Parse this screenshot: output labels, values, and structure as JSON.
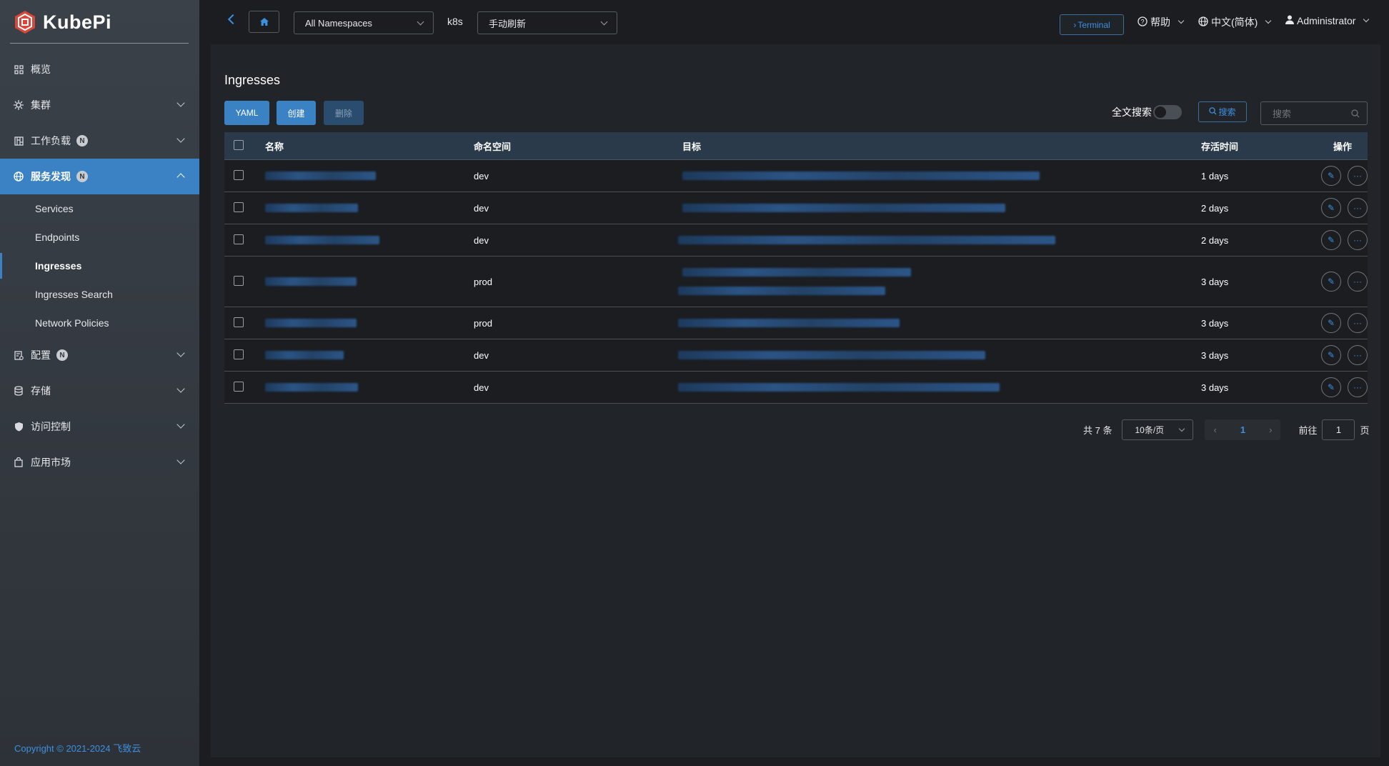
{
  "app": {
    "logo_text": "KubePi"
  },
  "topbar": {
    "namespace_select": "All Namespaces",
    "cluster": "k8s",
    "refresh_select": "手动刷新",
    "terminal_label": "Terminal",
    "help_label": "帮助",
    "language_label": "中文(简体)",
    "user_label": "Administrator"
  },
  "sidebar": {
    "items": [
      {
        "label": "概览",
        "icon": "dashboard-icon",
        "expandable": false
      },
      {
        "label": "集群",
        "icon": "cluster-icon",
        "expandable": true
      },
      {
        "label": "工作负载",
        "icon": "workload-icon",
        "expandable": true,
        "badge": "N"
      },
      {
        "label": "服务发现",
        "icon": "globe-icon",
        "expandable": true,
        "badge": "N",
        "active": true
      },
      {
        "label": "配置",
        "icon": "config-icon",
        "expandable": true,
        "badge": "N"
      },
      {
        "label": "存储",
        "icon": "database-icon",
        "expandable": true
      },
      {
        "label": "访问控制",
        "icon": "shield-icon",
        "expandable": true
      },
      {
        "label": "应用市场",
        "icon": "bag-icon",
        "expandable": true
      }
    ],
    "submenu": [
      "Services",
      "Endpoints",
      "Ingresses",
      "Ingresses Search",
      "Network Policies"
    ],
    "submenu_current": "Ingresses",
    "copyright": "Copyright © 2021-2024 飞致云"
  },
  "page": {
    "title": "Ingresses",
    "buttons": {
      "yaml": "YAML",
      "create": "创建",
      "delete": "删除"
    },
    "fulltext_label": "全文搜索",
    "search_button": "搜索",
    "search_placeholder": "搜索"
  },
  "table": {
    "headers": {
      "name": "名称",
      "namespace": "命名空间",
      "target": "目标",
      "age": "存活时间",
      "ops": "操作"
    },
    "rows": [
      {
        "namespace": "dev",
        "age": "1 days"
      },
      {
        "namespace": "dev",
        "age": "2 days"
      },
      {
        "namespace": "dev",
        "age": "2 days"
      },
      {
        "namespace": "prod",
        "age": "3 days"
      },
      {
        "namespace": "prod",
        "age": "3 days"
      },
      {
        "namespace": "dev",
        "age": "3 days"
      },
      {
        "namespace": "dev",
        "age": "3 days"
      }
    ]
  },
  "pagination": {
    "total_label": "共 7 条",
    "page_size": "10条/页",
    "current_page": "1",
    "goto_label": "前往",
    "goto_value": "1",
    "page_suffix": "页"
  },
  "colors": {
    "accent": "#3b82c4",
    "link": "#3d8fe0",
    "background": "#1b1d21",
    "panel": "#212428",
    "sidebar": "#3b4149"
  }
}
